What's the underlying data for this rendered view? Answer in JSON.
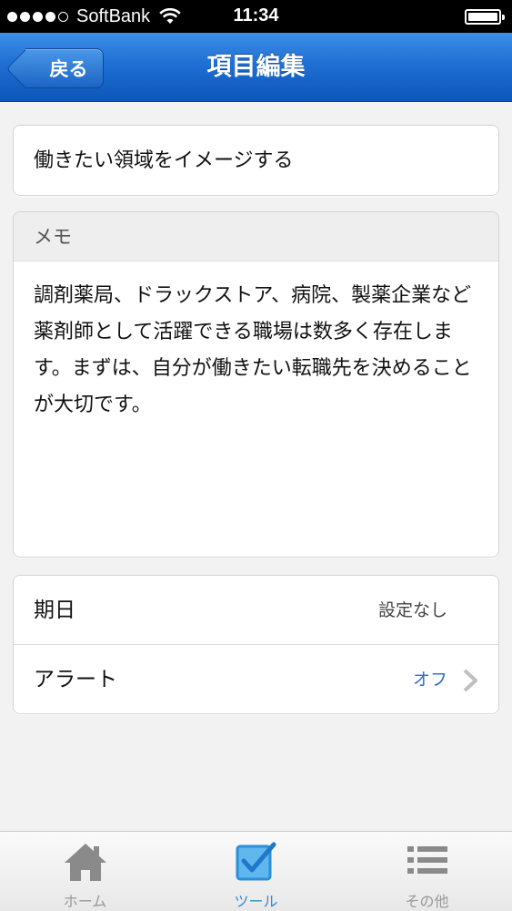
{
  "status_bar": {
    "carrier": "SoftBank",
    "time": "11:34"
  },
  "nav": {
    "back_label": "戻る",
    "title": "項目編集"
  },
  "item": {
    "title": "働きたい領域をイメージする"
  },
  "memo": {
    "header": "メモ",
    "body": "調剤薬局、ドラックストア、病院、製薬企業など薬剤師として活躍できる職場は数多く存在します。まずは、自分が働きたい転職先を決めることが大切です。"
  },
  "settings": {
    "due_label": "期日",
    "due_value": "設定なし",
    "alert_label": "アラート",
    "alert_value": "オフ"
  },
  "tabs": [
    {
      "label": "ホーム",
      "icon": "home-icon"
    },
    {
      "label": "ツール",
      "icon": "checkbox-icon"
    },
    {
      "label": "その他",
      "icon": "list-icon"
    }
  ],
  "colors": {
    "nav_blue": "#1f6fd4",
    "accent_blue": "#2d6fd6",
    "active_tab": "#2a8fd8"
  }
}
